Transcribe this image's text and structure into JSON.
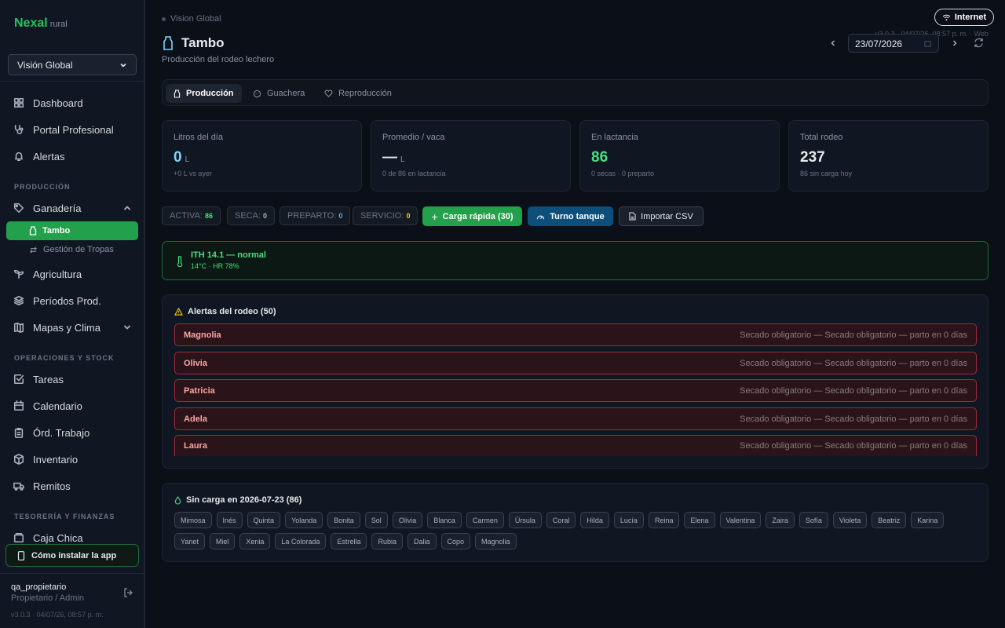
{
  "sidebar": {
    "brand": "Nexal",
    "brand_sub": "rural",
    "scope_select": "Visión Global",
    "items": {
      "dashboard": "Dashboard",
      "portal": "Portal Profesional",
      "alertas": "Alertas",
      "ganaderia": "Ganadería",
      "tambo": "Tambo",
      "tropas": "Gestión de Tropas",
      "agricultura": "Agricultura",
      "periodos": "Períodos Prod.",
      "mapas": "Mapas y Clima",
      "tareas": "Tareas",
      "calendario": "Calendario",
      "ordenes": "Órd. Trabajo",
      "inventario": "Inventario",
      "remitos": "Remitos",
      "caja": "Caja Chica"
    },
    "sections": {
      "produccion": "PRODUCCIÓN",
      "operaciones": "OPERACIONES Y STOCK",
      "tesoreria": "TESORERÍA Y FINANZAS"
    },
    "install_label": "Cómo instalar la app",
    "user": "qa_propietario",
    "role": "Propietario / Admin",
    "version": "v3.0.3 · 04/07/26, 08:57 p. m."
  },
  "header": {
    "breadcrumb": "Vision Global",
    "title": "Tambo",
    "subtitle": "Producción del rodeo lechero",
    "connection": "Internet",
    "version": "v3.0.3 · 04/07/26, 08:57 p. m. · Web",
    "date": "23/07/2026"
  },
  "tabs": {
    "produccion": "Producción",
    "guachera": "Guachera",
    "reproduccion": "Reproducción"
  },
  "cards": [
    {
      "label": "Litros del día",
      "value": "0",
      "unit": "L",
      "note": "+0 L vs ayer",
      "color": "#7dd3fc"
    },
    {
      "label": "Promedio / vaca",
      "value": "—",
      "unit": "L",
      "note": "0 de 86 en lactancia",
      "color": "#ffffff"
    },
    {
      "label": "En lactancia",
      "value": "86",
      "unit": "",
      "note": "0 secas · 0 preparto",
      "color": "#4ade80"
    },
    {
      "label": "Total rodeo",
      "value": "237",
      "unit": "",
      "note": "86 sin carga hoy",
      "color": "#ffffff"
    }
  ],
  "status_pills": {
    "activa_label": "ACTIVA:",
    "activa": "86",
    "seca_label": "SECA:",
    "seca": "0",
    "preparto_label": "PREPARTO:",
    "preparto": "0",
    "servicio_label": "SERVICIO:",
    "servicio": "0"
  },
  "actions": {
    "carga": "Carga rápida (30)",
    "turno": "Turno tanque",
    "importar": "Importar CSV"
  },
  "ith": {
    "title": "ITH 14.1 — normal",
    "detail": "14°C · HR 78%"
  },
  "alerts": {
    "title": "Alertas del rodeo (50)",
    "rows": [
      {
        "name": "Magnolia",
        "msg": "Secado obligatorio — Secado obligatorio — parto en 0 días"
      },
      {
        "name": "Olivia",
        "msg": "Secado obligatorio — Secado obligatorio — parto en 0 días"
      },
      {
        "name": "Patricia",
        "msg": "Secado obligatorio — Secado obligatorio — parto en 0 días"
      },
      {
        "name": "Adela",
        "msg": "Secado obligatorio — Secado obligatorio — parto en 0 días"
      },
      {
        "name": "Laura",
        "msg": "Secado obligatorio — Secado obligatorio — parto en 0 días"
      }
    ]
  },
  "sin_carga": {
    "title": "Sin carga en 2026-07-23 (86)",
    "chips": [
      "Mimosa",
      "Inés",
      "Quinta",
      "Yolanda",
      "Bonita",
      "Sol",
      "Olivia",
      "Blanca",
      "Carmen",
      "Úrsula",
      "Coral",
      "Hilda",
      "Lucía",
      "Reina",
      "Elena",
      "Valentina",
      "Zaira",
      "Sofía",
      "Violeta",
      "Beatriz",
      "Karina",
      "Yanet",
      "Miel",
      "Xenia",
      "La Colorada",
      "Estrella",
      "Rubia",
      "Dalia",
      "Copo",
      "Magnolia"
    ]
  }
}
